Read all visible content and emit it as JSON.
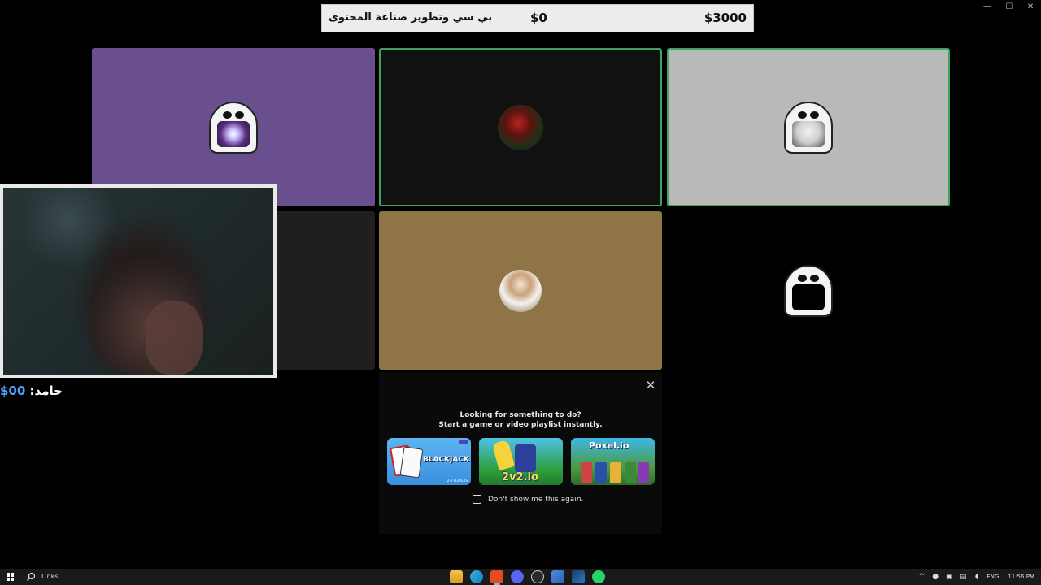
{
  "window": {
    "minimize": "—",
    "maximize": "☐",
    "close": "✕"
  },
  "score_banner": {
    "title": "بي سي وتطوير صناعة المحتوى",
    "middle_amount": "$0",
    "right_amount": "$3000"
  },
  "tiles": [
    {
      "id": "purple",
      "avatar": "ghost-storm"
    },
    {
      "id": "dark-red",
      "avatar": "red-circle"
    },
    {
      "id": "grey-cat",
      "avatar": "ghost-cat"
    },
    {
      "id": "dark-empty",
      "avatar": ""
    },
    {
      "id": "brown-person",
      "avatar": "person-circle"
    },
    {
      "id": "black-ghost",
      "avatar": "ghost-dark"
    }
  ],
  "streamer_label": {
    "name": "حامد:",
    "amount": "00$"
  },
  "activity": {
    "line1": "Looking for something to do?",
    "line2": "Start a game or video playlist instantly.",
    "close_icon": "✕",
    "cards": [
      {
        "name": "blackjack",
        "label": "BLACKJACK",
        "sub": "2-8 PLAYERS"
      },
      {
        "name": "2v2io",
        "label": "2v2.io"
      },
      {
        "name": "poxelio",
        "label": "Poxel.io"
      }
    ],
    "checkbox_label": "Don't show me this again."
  },
  "taskbar": {
    "search_label": "Links",
    "tray": {
      "chevron": "^",
      "lang": "ENG",
      "time": "11:56 PM"
    },
    "apps": [
      "file-explorer",
      "edge",
      "brave",
      "discord",
      "obs",
      "app-blue",
      "steam",
      "whatsapp"
    ]
  }
}
